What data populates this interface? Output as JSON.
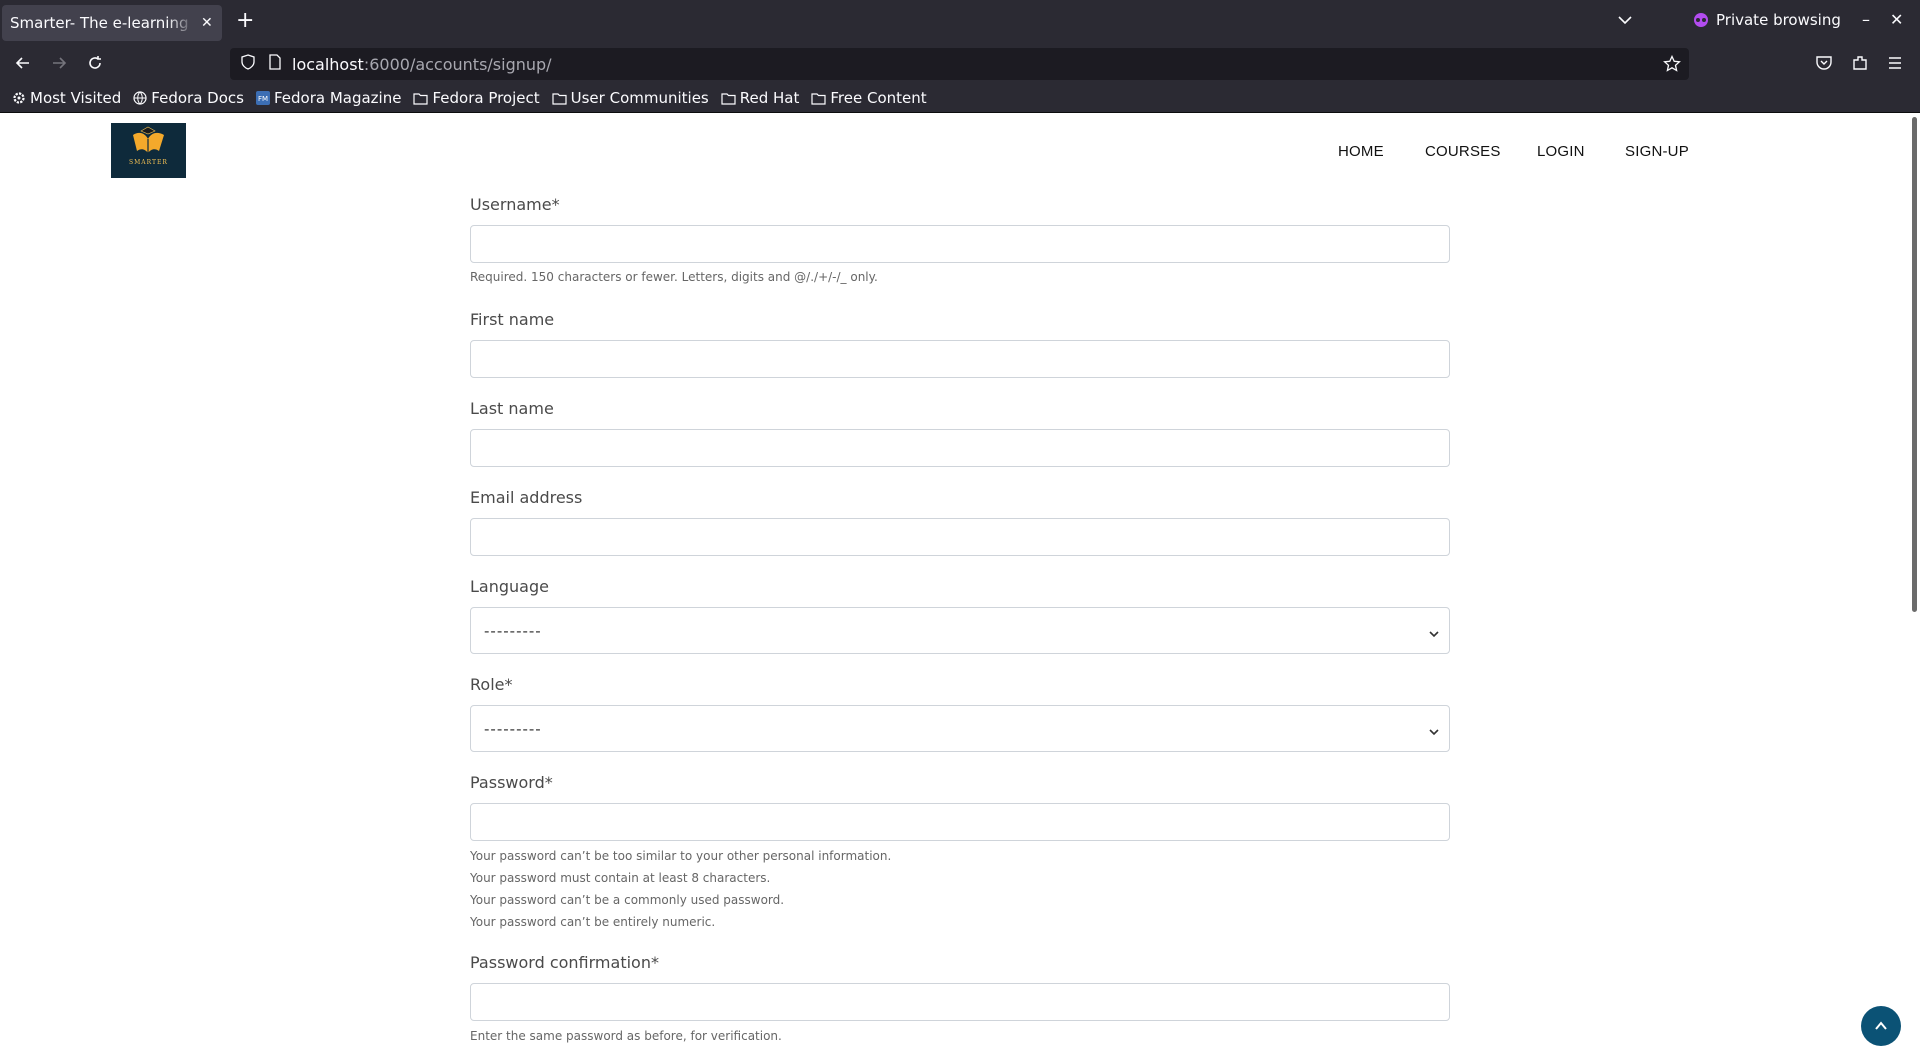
{
  "browser": {
    "tab_title": "Smarter- The e-learning",
    "new_tab": "+",
    "private_label": "Private browsing",
    "url_host": "localhost",
    "url_rest": ":6000/accounts/signup/",
    "bookmarks": [
      {
        "label": "Most Visited",
        "icon": "gear-icon"
      },
      {
        "label": "Fedora Docs",
        "icon": "globe-icon"
      },
      {
        "label": "Fedora Magazine",
        "icon": "fm-icon"
      },
      {
        "label": "Fedora Project",
        "icon": "folder-icon"
      },
      {
        "label": "User Communities",
        "icon": "folder-icon"
      },
      {
        "label": "Red Hat",
        "icon": "folder-icon"
      },
      {
        "label": "Free Content",
        "icon": "folder-icon"
      }
    ]
  },
  "site": {
    "logo_text": "SMARTER",
    "nav": {
      "home": "HOME",
      "courses": "COURSES",
      "login": "LOGIN",
      "signup": "SIGN-UP"
    }
  },
  "form": {
    "username_label": "Username*",
    "username_help": "Required. 150 characters or fewer. Letters, digits and @/./+/-/_ only.",
    "first_name_label": "First name",
    "last_name_label": "Last name",
    "email_label": "Email address",
    "language_label": "Language",
    "language_value": "---------",
    "role_label": "Role*",
    "role_value": "---------",
    "password_label": "Password*",
    "password_help": [
      "Your password can’t be too similar to your other personal information.",
      "Your password must contain at least 8 characters.",
      "Your password can’t be a commonly used password.",
      "Your password can’t be entirely numeric."
    ],
    "password_confirm_label": "Password confirmation*",
    "password_confirm_help": "Enter the same password as before, for verification."
  },
  "colors": {
    "accent": "#0b5275",
    "chrome": "#2b2a33",
    "logo_bg": "#0e2a3b"
  }
}
